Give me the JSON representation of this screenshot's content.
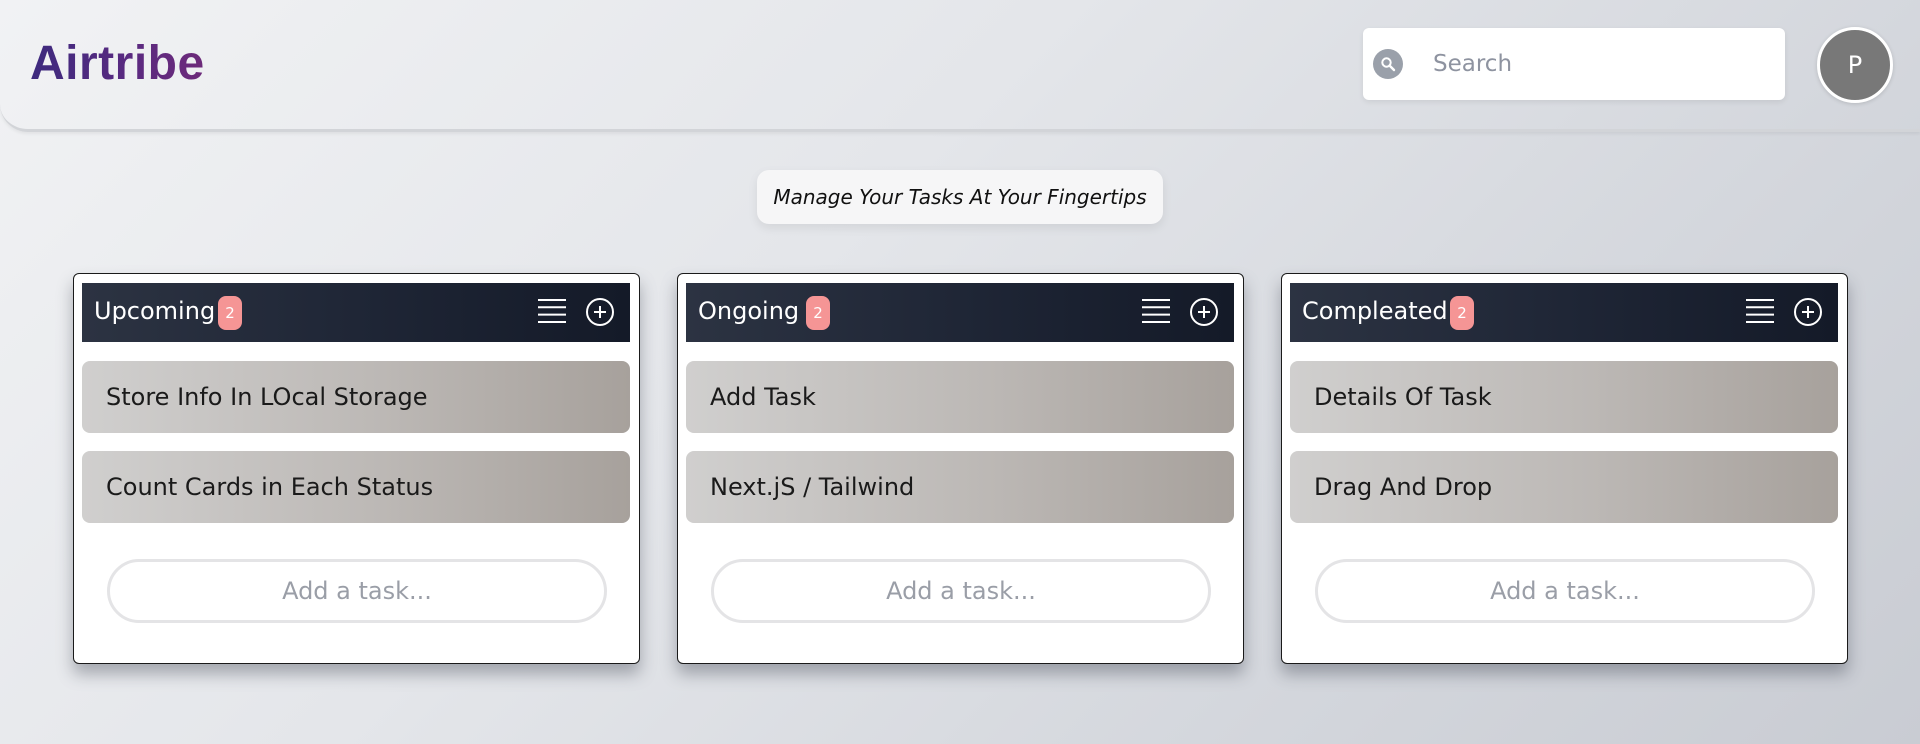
{
  "header": {
    "logo": "Airtribe",
    "search_placeholder": "Search",
    "avatar_initial": "P"
  },
  "tagline": "Manage Your Tasks At Your Fingertips",
  "columns": [
    {
      "title": "Upcoming",
      "count": "2",
      "tasks": [
        "Store Info In LOcal Storage",
        "Count Cards in Each Status"
      ],
      "add_placeholder": "Add a task..."
    },
    {
      "title": "Ongoing",
      "count": "2",
      "tasks": [
        "Add Task",
        "Next.jS / Tailwind"
      ],
      "add_placeholder": "Add a task..."
    },
    {
      "title": "Compleated",
      "count": "2",
      "tasks": [
        "Details Of Task",
        "Drag And Drop"
      ],
      "add_placeholder": "Add a task..."
    }
  ],
  "icons": {
    "search": "search-icon",
    "list": "list-icon",
    "add": "plus-circle-icon"
  },
  "colors": {
    "header_bar": "#1f2636",
    "badge": "#f59595",
    "logo_start": "#3d2a7e",
    "logo_end": "#6d2a7a",
    "avatar": "#787878"
  }
}
